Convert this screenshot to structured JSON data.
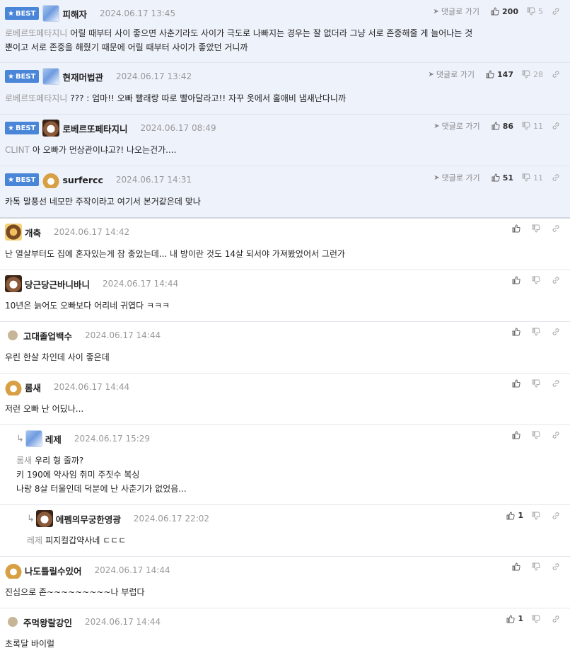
{
  "ui": {
    "best_label": "BEST",
    "reply_link": "댓글로 가기"
  },
  "comments": [
    {
      "best": true,
      "nick": "피해자",
      "date": "2024.06.17 13:45",
      "up": "200",
      "down": "5",
      "mention": "로베르또페타지니",
      "text": "어릴 때부터 사이 좋으면 사춘기라도 사이가 극도로 나빠지는 경우는 잘 없더라 그냥 서로 존중해줄 게 늘어나는 것",
      "text2": "뿐이고 서로 존중을 해줬기 때문에 어릴 때부터 사이가 좋았던 거니까"
    },
    {
      "best": true,
      "nick": "현재머법관",
      "date": "2024.06.17 13:42",
      "up": "147",
      "down": "28",
      "mention": "로베르또페타지니",
      "text": "??? : 엄마!! 오빠 빨래랑 따로 빨아달라고!! 자꾸 옷에서 홀애비 냄새난다니까"
    },
    {
      "best": true,
      "nick": "로베르또페타지니",
      "date": "2024.06.17 08:49",
      "up": "86",
      "down": "11",
      "mention": "CLINT",
      "text": "아 오빠가 먼상관이냐고?! 나오는건가...."
    },
    {
      "best": true,
      "nick": "surfercc",
      "date": "2024.06.17 14:31",
      "up": "51",
      "down": "11",
      "text": "카톡 말풍선 네모만 주작이라고 여기서 본거같은데 맞나"
    },
    {
      "nick": "개축",
      "date": "2024.06.17 14:42",
      "text": "난 열살부터도 집에 혼자있는게 참 좋았는데... 내 방이란 것도 14살 되서야 가져봤었어서 그런가"
    },
    {
      "nick": "당근당근바니바니",
      "date": "2024.06.17 14:44",
      "text": "10년은 늙어도 오빠보다 어리네 귀엽다 ㅋㅋㅋ"
    },
    {
      "nick": "고대졸업백수",
      "date": "2024.06.17 14:44",
      "text": "우린 한살 차인데 사이 좋은데"
    },
    {
      "nick": "롬새",
      "date": "2024.06.17 14:44",
      "text": "저런 오빠 난 어딨나..."
    },
    {
      "nick": "레제",
      "date": "2024.06.17 15:29",
      "mention": "롬새",
      "text": "우리 형 줄까?",
      "text2": "키 190에 약사임 취미 주짓수 복싱",
      "text3": "나랑 8살 터울인데 덕분에 난 사춘기가 없었음..."
    },
    {
      "nick": "에펨의무궁한영광",
      "date": "2024.06.17 22:02",
      "up": "1",
      "mention": "레제",
      "text": "피지컬갑약사네 ㄷㄷㄷ"
    },
    {
      "nick": "나도틀릴수있어",
      "date": "2024.06.17 14:44",
      "text": "진심으로 존~~~~~~~~~나 부럽다"
    },
    {
      "nick": "주먹왕랄강인",
      "date": "2024.06.17 14:44",
      "up": "1",
      "text": "초록달 바이럴"
    }
  ]
}
